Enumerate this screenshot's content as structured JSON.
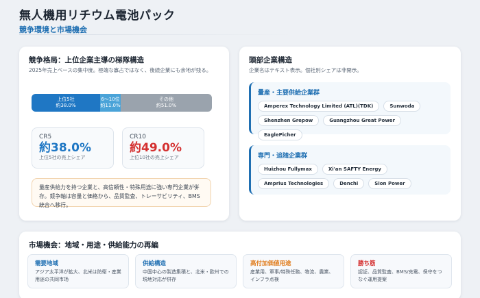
{
  "header": {
    "title": "無人機用リチウム電池パック",
    "subtitle": "競争環境と市場機会"
  },
  "competition": {
    "heading": "競争格局：上位企業主導の梯隊構造",
    "subtitle": "2025年売上ベースの集中度。極端な寡占ではなく、後続企業にも余地が残る。",
    "bar": [
      {
        "label": "上位5社",
        "value": "約38.0%",
        "share": 38.0,
        "color": "#1f77c4"
      },
      {
        "label": "6〜10位",
        "value": "約11.0%",
        "share": 11.0,
        "color": "#4aa3d8"
      },
      {
        "label": "その他",
        "value": "約51.0%",
        "share": 51.0,
        "color": "#9aa3ad"
      }
    ],
    "cr5": {
      "label": "CR5",
      "value": "約38.0%",
      "note": "上位5社の売上シェア",
      "color": "#1f77c4"
    },
    "cr10": {
      "label": "CR10",
      "value": "約49.0%",
      "note": "上位10社の売上シェア",
      "color": "#d43030"
    },
    "note": "量産供給力を持つ企業と、高信頼性・特殊用途に強い専門企業が併存。競争軸は容量と価格から、品質監査、トレーサビリティ、BMS統合へ移行。"
  },
  "leaders": {
    "heading": "頭部企業構造",
    "subtitle": "企業名はテキスト表示。個社別シェアは非開示。",
    "groups": [
      {
        "title": "量産・主要供給企業群",
        "companies": [
          "Amperex Technology Limited (ATL)(TDK)",
          "Sunwoda",
          "Shenzhen Grepow",
          "Guangzhou Great Power",
          "EaglePicher"
        ]
      },
      {
        "title": "専門・追随企業群",
        "companies": [
          "Huizhou Fullymax",
          "Xi'an SAFTY Energy",
          "Amprius Technologies",
          "Denchi",
          "Sion Power"
        ]
      }
    ]
  },
  "opportunity": {
    "heading": "市場機会：地域・用途・供給能力の再編",
    "cards": [
      {
        "title": "需要地域",
        "text": "アジア太平洋が拡大、北米は防衛・産業用途の共同市场",
        "color": "#1f6fb2"
      },
      {
        "title": "供給構造",
        "text": "中国中心の製造集積と、北米・欧州での現地対応が併存",
        "color": "#1f6fb2"
      },
      {
        "title": "高付加価値用途",
        "text": "産業用、軍事/特殊任務、物流、農業、インフラ点検",
        "color": "#e07b1a"
      },
      {
        "title": "勝ち筋",
        "text": "認証、品質監査、BMS/充電、保守をつなぐ運用提案",
        "color": "#d43030"
      }
    ]
  }
}
